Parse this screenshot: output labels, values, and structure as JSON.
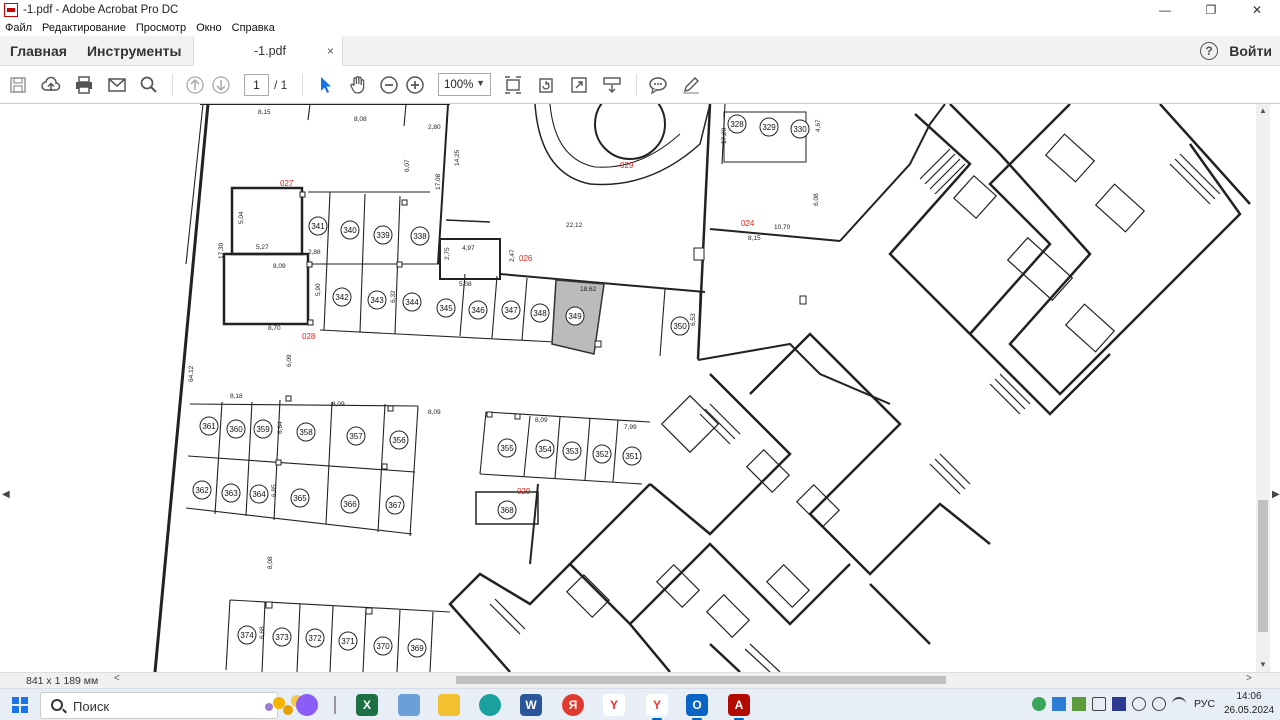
{
  "window": {
    "title": "-1.pdf - Adobe Acrobat Pro DC",
    "minimize": "—",
    "restore": "❐",
    "close": "✕"
  },
  "menu": [
    "Файл",
    "Редактирование",
    "Просмотр",
    "Окно",
    "Справка"
  ],
  "tabs": {
    "home": "Главная",
    "tools": "Инструменты",
    "document": "-1.pdf",
    "close": "×",
    "help": "?",
    "login": "Войти"
  },
  "toolbar": {
    "page_current": "1",
    "page_total": "/ 1",
    "zoom": "100%",
    "icons": [
      "save-icon",
      "upload-icon",
      "print-icon",
      "email-icon",
      "search-icon",
      "prev-page-icon",
      "next-page-icon",
      "select-cursor-icon",
      "hand-icon",
      "zoom-out-icon",
      "zoom-in-icon",
      "fit-page-icon",
      "rotate-icon",
      "fullscreen-icon",
      "scroll-mode-icon",
      "comment-icon",
      "pen-icon"
    ]
  },
  "document": {
    "page_size": "841 x 1 189 мм",
    "plan_codes": [
      "027",
      "028",
      "026",
      "024",
      "029",
      "029"
    ],
    "parking_spots_top": [
      "341",
      "340",
      "339",
      "338",
      "342",
      "343",
      "344",
      "345",
      "346",
      "347",
      "348",
      "349",
      "350",
      "328",
      "329",
      "330"
    ],
    "parking_spots_mid": [
      "361",
      "360",
      "359",
      "358",
      "357",
      "356",
      "362",
      "363",
      "364",
      "365",
      "366",
      "367",
      "355",
      "354",
      "353",
      "352",
      "351",
      "368"
    ],
    "parking_spots_bottom": [
      "374",
      "373",
      "372",
      "371",
      "370",
      "369"
    ],
    "dimensions": [
      "8,15",
      "8,08",
      "2,80",
      "6,07",
      "14,25",
      "17,08",
      "5,04",
      "5,27",
      "17,30",
      "2,88",
      "8,09",
      "5,90",
      "6,32",
      "4,97",
      "2,75",
      "2,47",
      "22,12",
      "5,08",
      "18,62",
      "8,70",
      "6,09",
      "64,12",
      "8,18",
      "8,09",
      "8,09",
      "8,09",
      "7,99",
      "6,64",
      "6,85",
      "8,08",
      "6,68",
      "17,20",
      "4,67",
      "6,08",
      "10,70",
      "8,15",
      "6,53"
    ]
  },
  "taskbar": {
    "search_label": "Поиск",
    "lang": "РУС",
    "time": "14:06",
    "date": "26.05.2024"
  },
  "colors": {
    "accent_red": "#d9261c",
    "plan_line": "#222222",
    "highlight_spot": "#bbbbbb",
    "taskbar_bg": "#e8eef5"
  }
}
